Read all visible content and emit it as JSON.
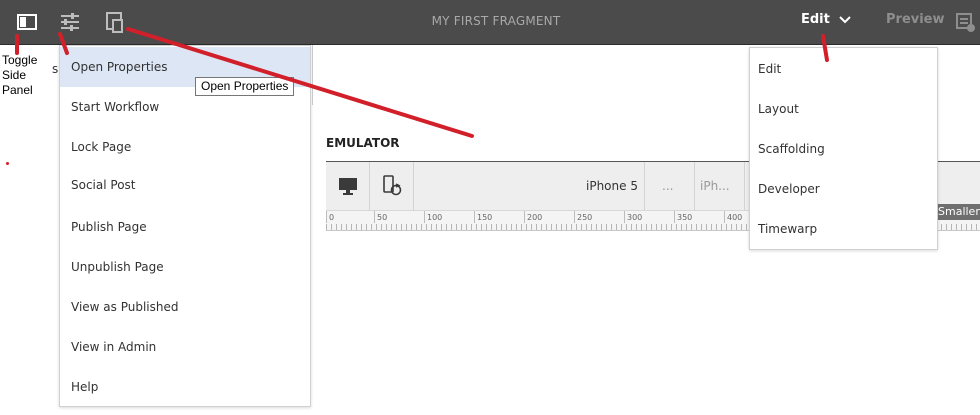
{
  "toolbar": {
    "title": "MY FIRST FRAGMENT",
    "toggle_side_panel_icon": "side-panel-icon",
    "page_properties_icon": "sliders-icon",
    "emulator_icon": "device-icon",
    "mode_label": "Edit",
    "preview_label": "Preview",
    "annotations_icon": "annotation-add-icon"
  },
  "annotation": {
    "line1": "Toggle",
    "line2": "Side",
    "line3": "Panel",
    "color": "#d1202a"
  },
  "side_panel": {
    "partial_text": "s"
  },
  "page_menu": {
    "items": [
      "Open Properties",
      "Start Workflow",
      "Lock Page",
      "Social Post",
      "Publish Page",
      "Unpublish Page",
      "View as Published",
      "View in Admin",
      "Help"
    ],
    "highlighted_item": "Open Properties",
    "tooltip": "Open Properties"
  },
  "emulator": {
    "title": "EMULATOR",
    "desktop_icon": "monitor-icon",
    "rotate_icon": "rotate-device-icon",
    "devices": [
      "iPhone 5",
      "...",
      "iPh..."
    ],
    "ruler_labels": [
      "0",
      "50",
      "100",
      "150",
      "200",
      "250",
      "300",
      "350",
      "400"
    ],
    "badge": "Smaller"
  },
  "mode_menu": {
    "items": [
      "Edit",
      "Layout",
      "Scaffolding",
      "Developer",
      "Timewarp"
    ]
  },
  "colors": {
    "toolbar_bg": "#4b4b4b",
    "highlight": "#dce6f4",
    "annotation_red": "#d1202a"
  }
}
